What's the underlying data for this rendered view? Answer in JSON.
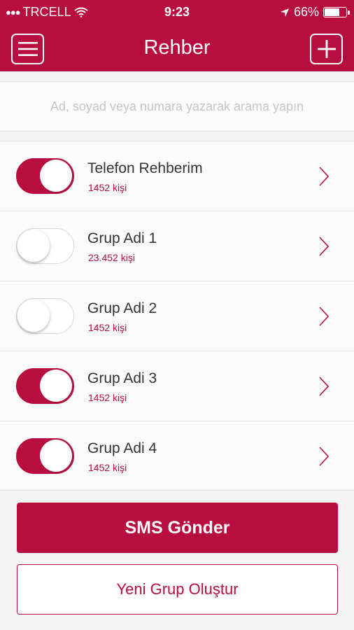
{
  "status_bar": {
    "carrier": "TRCELL",
    "time": "9:23",
    "battery": "66%",
    "battery_level": 0.66
  },
  "nav": {
    "title": "Rehber",
    "menu_icon": "hamburger-menu-icon",
    "add_icon": "plus-icon"
  },
  "search": {
    "placeholder": "Ad, soyad veya numara yazarak arama yapın"
  },
  "groups": [
    {
      "name": "Telefon Rehberim",
      "count": "1452 kişi",
      "enabled": true
    },
    {
      "name": "Grup Adi 1",
      "count": "23.452 kişi",
      "enabled": false
    },
    {
      "name": "Grup Adi 2",
      "count": "1452 kişi",
      "enabled": false
    },
    {
      "name": "Grup Adi 3",
      "count": "1452 kişi",
      "enabled": true
    },
    {
      "name": "Grup Adi 4",
      "count": "1452 kişi",
      "enabled": true
    }
  ],
  "actions": {
    "send_sms": "SMS Gönder",
    "new_group": "Yeni Grup Oluştur"
  },
  "colors": {
    "accent": "#b80d3f",
    "background": "#f4f4f4",
    "text": "#333333"
  }
}
